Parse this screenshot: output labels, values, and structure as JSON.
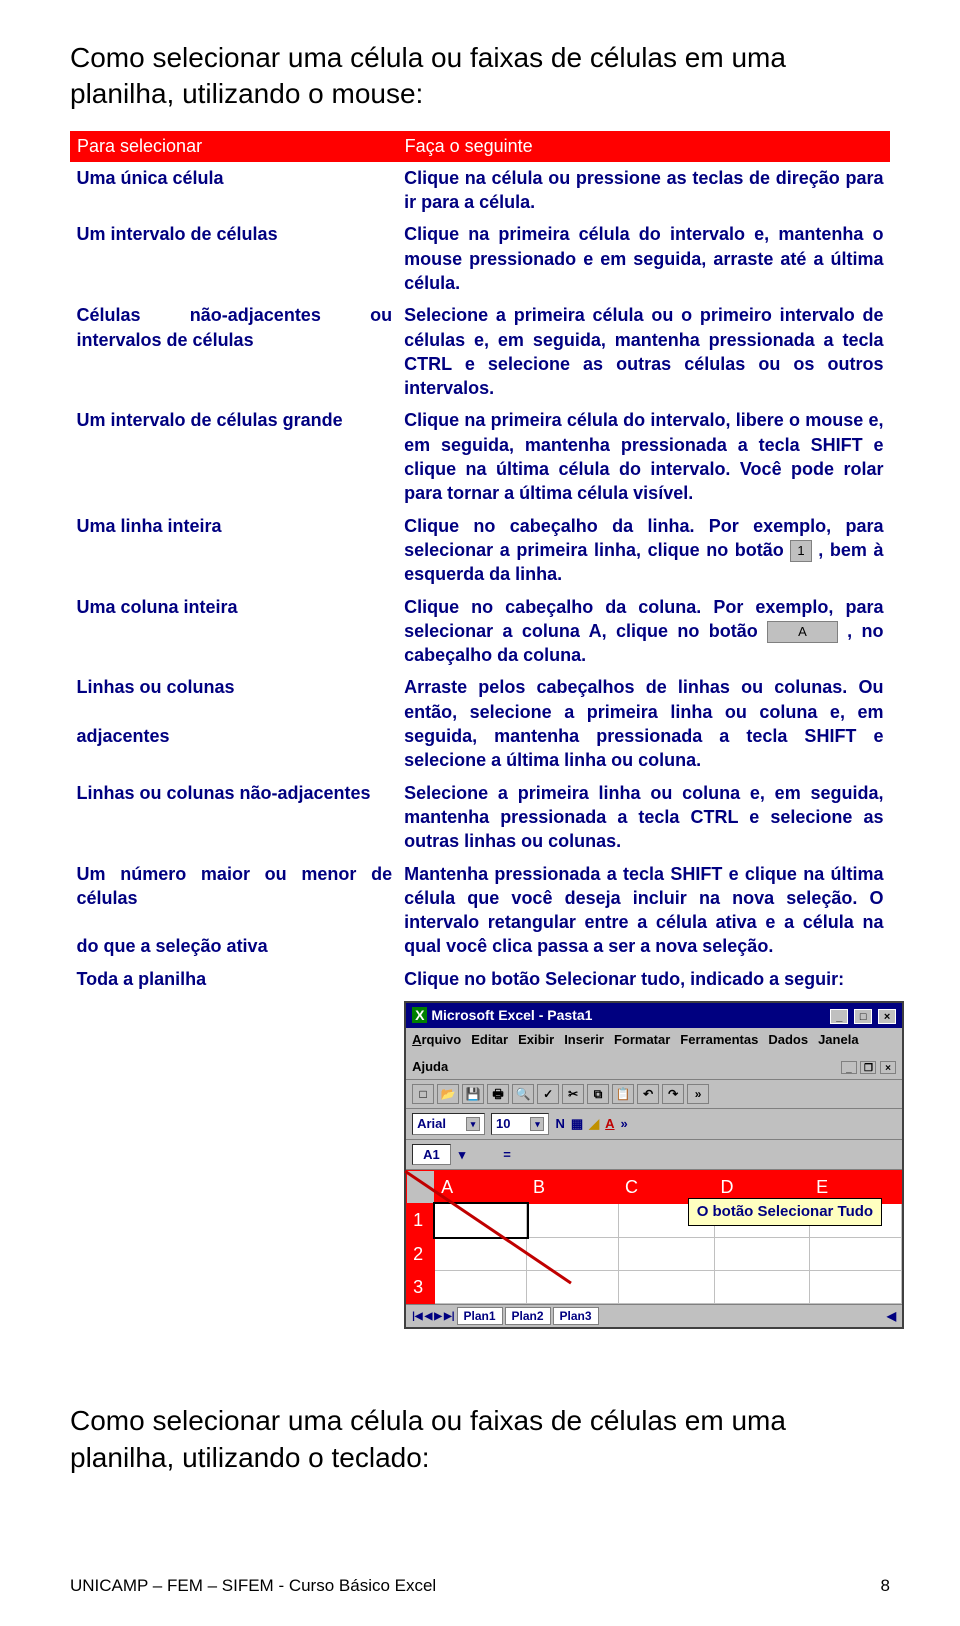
{
  "heading": "Como selecionar uma célula ou faixas de células em uma planilha, utilizando o mouse:",
  "header": {
    "left": "Para selecionar",
    "right": "Faça o seguinte"
  },
  "rows": [
    {
      "left": "Uma única célula",
      "right": "Clique na célula ou pressione as teclas de direção para ir para a célula."
    },
    {
      "left": "Um intervalo de células",
      "right": "Clique na primeira célula do intervalo e, mantenha o mouse pressionado e em seguida, arraste até a última célula."
    },
    {
      "left": "Células não-adjacentes ou intervalos de células",
      "right": "Selecione a primeira célula ou o primeiro intervalo de células e, em seguida, mantenha pressionada a tecla CTRL e selecione as outras células ou os outros intervalos."
    },
    {
      "left": "Um intervalo de células grande",
      "right": "Clique na primeira célula do intervalo, libere o mouse e, em seguida, mantenha pressionada a tecla SHIFT e clique na última célula do intervalo. Você pode rolar para tornar a última célula visível."
    },
    {
      "left": "Uma linha inteira",
      "right_parts": {
        "a": "Clique no cabeçalho da linha. Por exemplo, para selecionar a primeira linha, clique no botão ",
        "btn": "1",
        "b": ", bem à esquerda da linha."
      }
    },
    {
      "left": "Uma coluna inteira",
      "right_parts": {
        "a": "Clique no cabeçalho da coluna. Por exemplo, para selecionar a coluna A, clique no botão ",
        "btn": "A",
        "b": ", no cabeçalho da coluna."
      }
    },
    {
      "left": "Linhas ou colunas\n\nadjacentes",
      "right": "Arraste pelos cabeçalhos de linhas ou colunas. Ou então, selecione a primeira linha ou coluna e, em seguida, mantenha pressionada a tecla SHIFT e selecione a última linha ou coluna."
    },
    {
      "left": "Linhas ou colunas não-adjacentes",
      "right": "Selecione a primeira linha ou coluna e, em seguida, mantenha pressionada a tecla CTRL e selecione as outras linhas ou colunas."
    },
    {
      "left": "Um número maior ou menor de células\n\ndo que a seleção ativa",
      "right": "Mantenha pressionada a tecla SHIFT e clique na última célula que você deseja incluir na nova seleção. O intervalo retangular entre a célula ativa e a célula na qual você clica passa a ser a nova seleção."
    },
    {
      "left": "Toda a planilha",
      "right": "Clique no botão Selecionar tudo, indicado a seguir:"
    }
  ],
  "excel": {
    "title": "Microsoft Excel - Pasta1",
    "menu": [
      "Arquivo",
      "Editar",
      "Exibir",
      "Inserir",
      "Formatar",
      "Ferramentas",
      "Dados",
      "Janela",
      "Ajuda"
    ],
    "font": "Arial",
    "size": "10",
    "namebox": "A1",
    "cols": [
      "A",
      "B",
      "C",
      "D",
      "E"
    ],
    "rownums": [
      "1",
      "2",
      "3"
    ],
    "callout": "O botão Selecionar Tudo",
    "tabs": [
      "Plan1",
      "Plan2",
      "Plan3"
    ]
  },
  "heading2": "Como selecionar uma célula ou faixas de células em uma planilha, utilizando o teclado:",
  "footer": {
    "left": "UNICAMP – FEM – SIFEM - Curso Básico Excel",
    "right": "8"
  }
}
